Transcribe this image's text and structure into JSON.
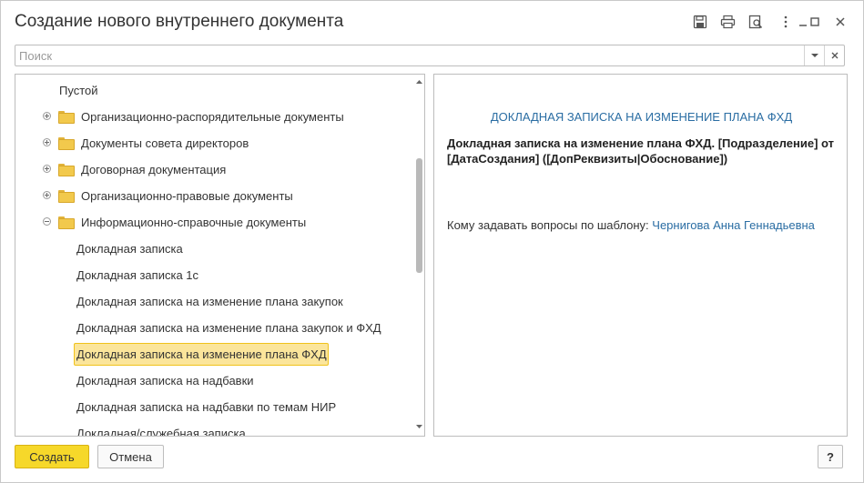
{
  "window": {
    "title": "Создание нового внутреннего документа"
  },
  "titlebar": {
    "icons": [
      "save-icon",
      "print-icon",
      "preview-icon",
      "more-icon",
      "minimize-icon",
      "maximize-icon",
      "close-icon"
    ]
  },
  "search": {
    "placeholder": "Поиск",
    "value": ""
  },
  "tree": {
    "rows": [
      {
        "label": "Пустой",
        "level": 0,
        "folder": false
      },
      {
        "label": "Организационно-распорядительные документы",
        "level": 0,
        "folder": true,
        "expanded": false
      },
      {
        "label": "Документы совета директоров",
        "level": 0,
        "folder": true,
        "expanded": false
      },
      {
        "label": "Договорная документация",
        "level": 0,
        "folder": true,
        "expanded": false
      },
      {
        "label": "Организационно-правовые документы",
        "level": 0,
        "folder": true,
        "expanded": false
      },
      {
        "label": "Информационно-справочные документы",
        "level": 0,
        "folder": true,
        "expanded": true
      },
      {
        "label": "Докладная записка",
        "level": 1,
        "folder": false
      },
      {
        "label": "Докладная записка 1с",
        "level": 1,
        "folder": false
      },
      {
        "label": "Докладная записка на изменение плана закупок",
        "level": 1,
        "folder": false
      },
      {
        "label": "Докладная записка на изменение плана закупок и ФХД",
        "level": 1,
        "folder": false
      },
      {
        "label": "Докладная записка на изменение плана ФХД",
        "level": 1,
        "folder": false,
        "selected": true
      },
      {
        "label": "Докладная записка на надбавки",
        "level": 1,
        "folder": false
      },
      {
        "label": "Докладная записка на надбавки по темам НИР",
        "level": 1,
        "folder": false
      },
      {
        "label": "Докладная/служебная записка",
        "level": 1,
        "folder": false
      }
    ]
  },
  "preview": {
    "heading": "ДОКЛАДНАЯ ЗАПИСКА НА ИЗМЕНЕНИЕ ПЛАНА ФХД",
    "title_template": "Докладная записка на изменение плана ФХД. [Подразделение] от [ДатаСоздания] ([ДопРеквизиты|Обоснование])",
    "questions_label": "Кому задавать вопросы по шаблону:",
    "questions_contact": "Чернигова Анна Геннадьевна"
  },
  "buttons": {
    "create": "Создать",
    "cancel": "Отмена",
    "help": "?"
  },
  "colors": {
    "accent_yellow": "#f6d82a",
    "selection": "#fbe59b",
    "link": "#2a6da3",
    "folder": "#f2c94c"
  }
}
